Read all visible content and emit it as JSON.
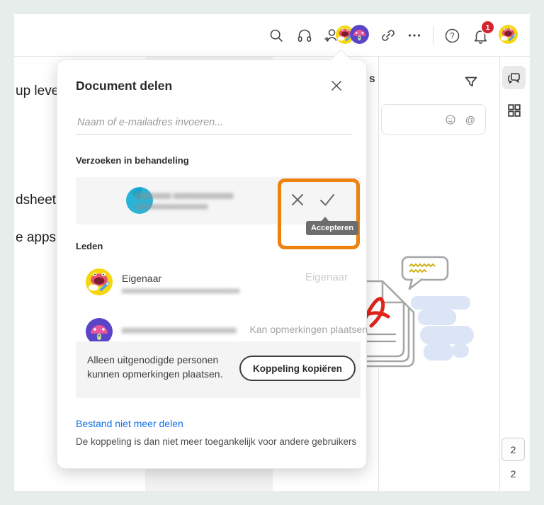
{
  "colors": {
    "frame_bg": "#e7edea",
    "accent_orange": "#ed820e",
    "link_blue": "#1473e6",
    "badge_red": "#d3262f",
    "acrobat_red": "#e1251b"
  },
  "topbar": {
    "notification_count": "1"
  },
  "document": {
    "fragments": [
      "up level",
      "dsheet",
      "e apps."
    ]
  },
  "comments_panel": {
    "heading_fragment": "s"
  },
  "right_rail": {
    "current_page": "2",
    "total_pages": "2"
  },
  "share_dialog": {
    "title": "Document delen",
    "input_placeholder": "Naam of e-mailadres invoeren...",
    "pending": {
      "label": "Verzoeken in behandeling",
      "name_redacted": "▅▅▅▅▅▅ ▅▅▅▅▅▅▅▅▅▅",
      "email_redacted": "▅▅▅▅▅▅▅▅▅▅▅▅▅▅",
      "tooltip": "Accepteren"
    },
    "members": {
      "label": "Leden",
      "rows": [
        {
          "name": "Eigenaar",
          "email_redacted": "▅▅▅▅▅▅▅▅▅▅▅▅▅▅▅▅▅▅▅▅▅▅▅▅",
          "role": "Eigenaar"
        },
        {
          "name_redacted": "▅▅▅▅▅▅▅▅▅▅▅▅▅▅▅▅▅▅▅▅",
          "role": "Kan opmerkingen plaatsen"
        }
      ]
    },
    "footer": {
      "note_line1": "Alleen uitgenodigde personen",
      "note_line2": "kunnen opmerkingen plaatsen.",
      "copy_link_button": "Koppeling kopiëren"
    },
    "unshare_link": "Bestand niet meer delen",
    "unshare_note": "De koppeling is dan niet meer toegankelijk voor andere gebruikers"
  }
}
